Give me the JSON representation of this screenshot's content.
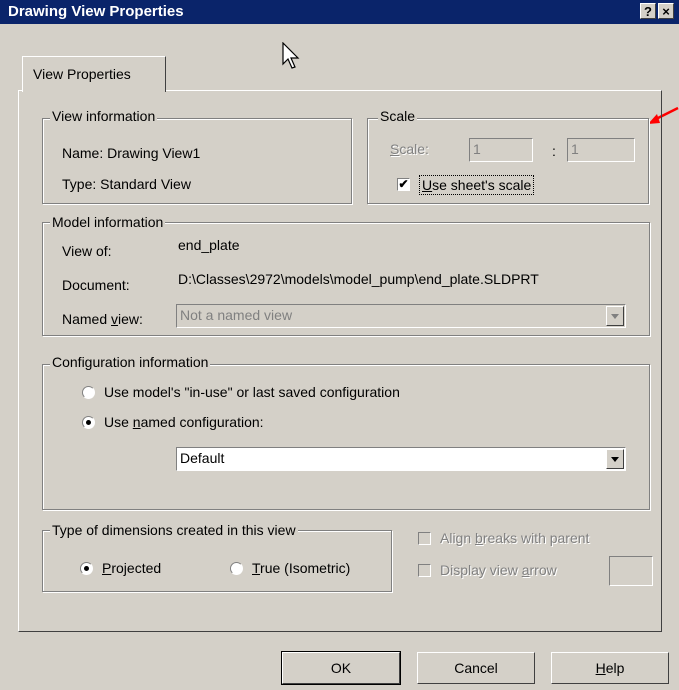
{
  "window": {
    "title": "Drawing View Properties",
    "help_btn": "?",
    "close_btn": "×",
    "title_color": "#0a246a"
  },
  "tabs": [
    {
      "label": "View Properties"
    }
  ],
  "view_info": {
    "legend": "View information",
    "name": "Name: Drawing View1",
    "type": "Type: Standard View"
  },
  "scale": {
    "legend": "Scale",
    "label": "Scale:",
    "left_value": "1",
    "separator": ":",
    "right_value": "1",
    "use_sheet_label": "Use sheet's scale",
    "use_sheet_checked": true,
    "check_mark": "✔"
  },
  "model_info": {
    "legend": "Model information",
    "view_of_label": "View of:",
    "view_of_value": "end_plate",
    "document_label": "Document:",
    "document_value": "D:\\Classes\\2972\\models\\model_pump\\end_plate.SLDPRT",
    "named_view_label": "Named view:",
    "named_view_value": "Not a named view"
  },
  "config_info": {
    "legend": "Configuration information",
    "option_in_use": "Use model's \"in-use\" or last saved configuration",
    "option_named": "Use named configuration:",
    "selected_option": "named",
    "configuration_value": "Default"
  },
  "dimensions": {
    "legend": "Type of dimensions created in this view",
    "projected": "Projected",
    "true_iso": "True (Isometric)",
    "selected": "projected"
  },
  "options": {
    "align_breaks": "Align breaks with parent",
    "display_arrow": "Display view arrow"
  },
  "buttons": {
    "ok": "OK",
    "cancel": "Cancel",
    "help": "Help"
  },
  "annotation": {
    "arrow_color": "#ff0000"
  }
}
